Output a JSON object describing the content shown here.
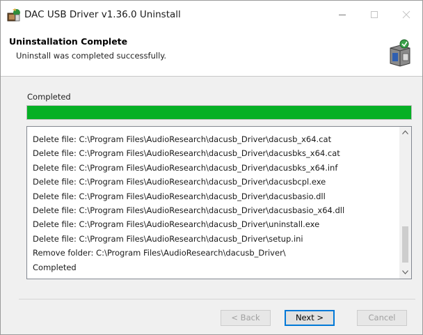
{
  "window": {
    "title": "DAC USB Driver v1.36.0 Uninstall",
    "icon": "installer-icon"
  },
  "header": {
    "title": "Uninstallation Complete",
    "subtitle": "Uninstall was completed successfully.",
    "icon": "installer-box-icon"
  },
  "progress": {
    "label": "Completed",
    "percent": 100,
    "color": "#06b025"
  },
  "log": {
    "lines": [
      "Delete file: C:\\Program Files\\AudioResearch\\dacusb_Driver\\dacusb_x64.cat",
      "Delete file: C:\\Program Files\\AudioResearch\\dacusb_Driver\\dacusbks_x64.cat",
      "Delete file: C:\\Program Files\\AudioResearch\\dacusb_Driver\\dacusbks_x64.inf",
      "Delete file: C:\\Program Files\\AudioResearch\\dacusb_Driver\\dacusbcpl.exe",
      "Delete file: C:\\Program Files\\AudioResearch\\dacusb_Driver\\dacusbasio.dll",
      "Delete file: C:\\Program Files\\AudioResearch\\dacusb_Driver\\dacusbasio_x64.dll",
      "Delete file: C:\\Program Files\\AudioResearch\\dacusb_Driver\\uninstall.exe",
      "Delete file: C:\\Program Files\\AudioResearch\\dacusb_Driver\\setup.ini",
      "Remove folder: C:\\Program Files\\AudioResearch\\dacusb_Driver\\",
      "Completed"
    ]
  },
  "buttons": {
    "back": "< Back",
    "next": "Next >",
    "cancel": "Cancel"
  },
  "colors": {
    "accent": "#0078d7",
    "progress": "#06b025"
  }
}
